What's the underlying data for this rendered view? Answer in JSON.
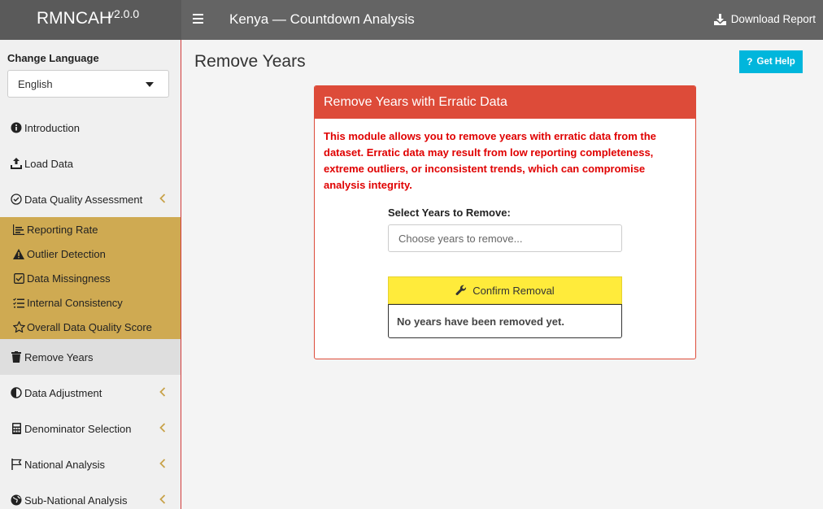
{
  "header": {
    "logo": "RMNCAH",
    "version": "v2.0.0",
    "title": "Kenya — Countdown Analysis",
    "download_label": "Download Report"
  },
  "sidebar": {
    "language_label": "Change Language",
    "language_value": "English",
    "items": [
      {
        "label": "Introduction",
        "icon": "info-circle-icon"
      },
      {
        "label": "Load Data",
        "icon": "upload-icon"
      },
      {
        "label": "Data Quality Assessment",
        "icon": "check-circle-icon"
      },
      {
        "label": "Remove Years",
        "icon": "trash-icon"
      },
      {
        "label": "Data Adjustment",
        "icon": "adjust-icon"
      },
      {
        "label": "Denominator Selection",
        "icon": "calculator-icon"
      },
      {
        "label": "National Analysis",
        "icon": "flag-icon"
      },
      {
        "label": "Sub-National Analysis",
        "icon": "globe-icon"
      }
    ],
    "sub_items": [
      {
        "label": "Reporting Rate",
        "icon": "chart-icon"
      },
      {
        "label": "Outlier Detection",
        "icon": "warning-icon"
      },
      {
        "label": "Data Missingness",
        "icon": "checkbox-icon"
      },
      {
        "label": "Internal Consistency",
        "icon": "list-check-icon"
      },
      {
        "label": "Overall Data Quality Score",
        "icon": "star-icon"
      }
    ]
  },
  "main": {
    "page_title": "Remove Years",
    "help_label": "Get Help",
    "box": {
      "title": "Remove Years with Erratic Data",
      "description": "This module allows you to remove years with erratic data from the dataset. Erratic data may result from low reporting completeness, extreme outliers, or inconsistent trends, which can compromise analysis integrity.",
      "select_label": "Select Years to Remove:",
      "select_placeholder": "Choose years to remove...",
      "confirm_label": "Confirm Removal",
      "status": "No years have been removed yet."
    }
  },
  "colors": {
    "header": "#646464",
    "danger": "#dd4b39",
    "submenu": "#cfaa52",
    "help": "#00b6dc",
    "confirm": "#ffeb3b"
  }
}
